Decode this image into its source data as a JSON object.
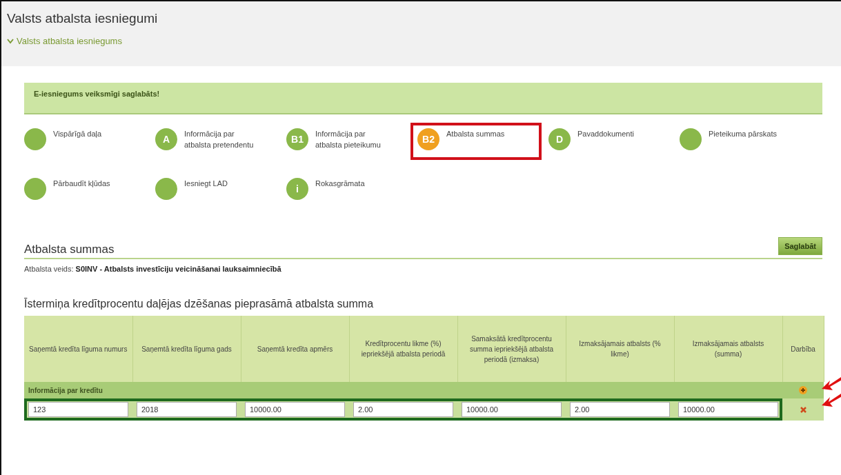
{
  "page_title": "Valsts atbalsta iesniegumi",
  "breadcrumb": {
    "label": "Valsts atbalsta iesniegums",
    "expanded": true
  },
  "success_message": "E-iesniegums veiksmīgi saglabāts!",
  "steps": [
    {
      "label": "Vispārīgā daļa",
      "selected": false,
      "highlighted": false
    },
    {
      "badge": "A",
      "label": "Informācija par atbalsta pretendentu",
      "selected": false,
      "highlighted": false
    },
    {
      "badge": "B1",
      "label": "Informācija par atbalsta pieteikumu",
      "selected": false,
      "highlighted": false
    },
    {
      "badge": "B2",
      "label": "Atbalsta summas",
      "selected": true,
      "highlighted": true
    },
    {
      "badge": "D",
      "label": "Pavaddokumenti",
      "selected": false,
      "highlighted": false
    },
    {
      "label": "Pieteikuma pārskats",
      "selected": false,
      "highlighted": false
    },
    {
      "label": "Pārbaudīt kļūdas",
      "selected": false,
      "highlighted": false
    },
    {
      "label": "Iesniegt LAD",
      "selected": false,
      "highlighted": false
    },
    {
      "badge": "i",
      "label": "Rokasgrāmata",
      "selected": false,
      "highlighted": false
    }
  ],
  "section": {
    "title": "Atbalsta summas",
    "save_button": "Saglabāt",
    "support_type_label": "Atbalsta veids:",
    "support_type_value": "S0INV - Atbalsts investīciju veicināšanai lauksaimniecībā"
  },
  "table": {
    "title": "Īstermiņa kredītprocentu daļējas dzēšanas pieprasāmā atbalsta summa",
    "columns": [
      "Saņemtā kredīta līguma numurs",
      "Saņemtā kredīta līguma gads",
      "Saņemtā kredīta apmērs",
      "Kredītprocentu likme (%) iepriekšējā atbalsta periodā",
      "Samaksātā kredītprocentu summa iepriekšējā atbalsta periodā (izmaksa)",
      "Izmaksājamais atbalsts (% likme)",
      "Izmaksājamais atbalsts (summa)",
      "Darbība"
    ],
    "group_label": "Informācija par kredītu",
    "rows": [
      {
        "values": [
          "123",
          "2018",
          "10000.00",
          "2.00",
          "10000.00",
          "2.00",
          "10000.00"
        ],
        "highlighted": true
      }
    ]
  }
}
